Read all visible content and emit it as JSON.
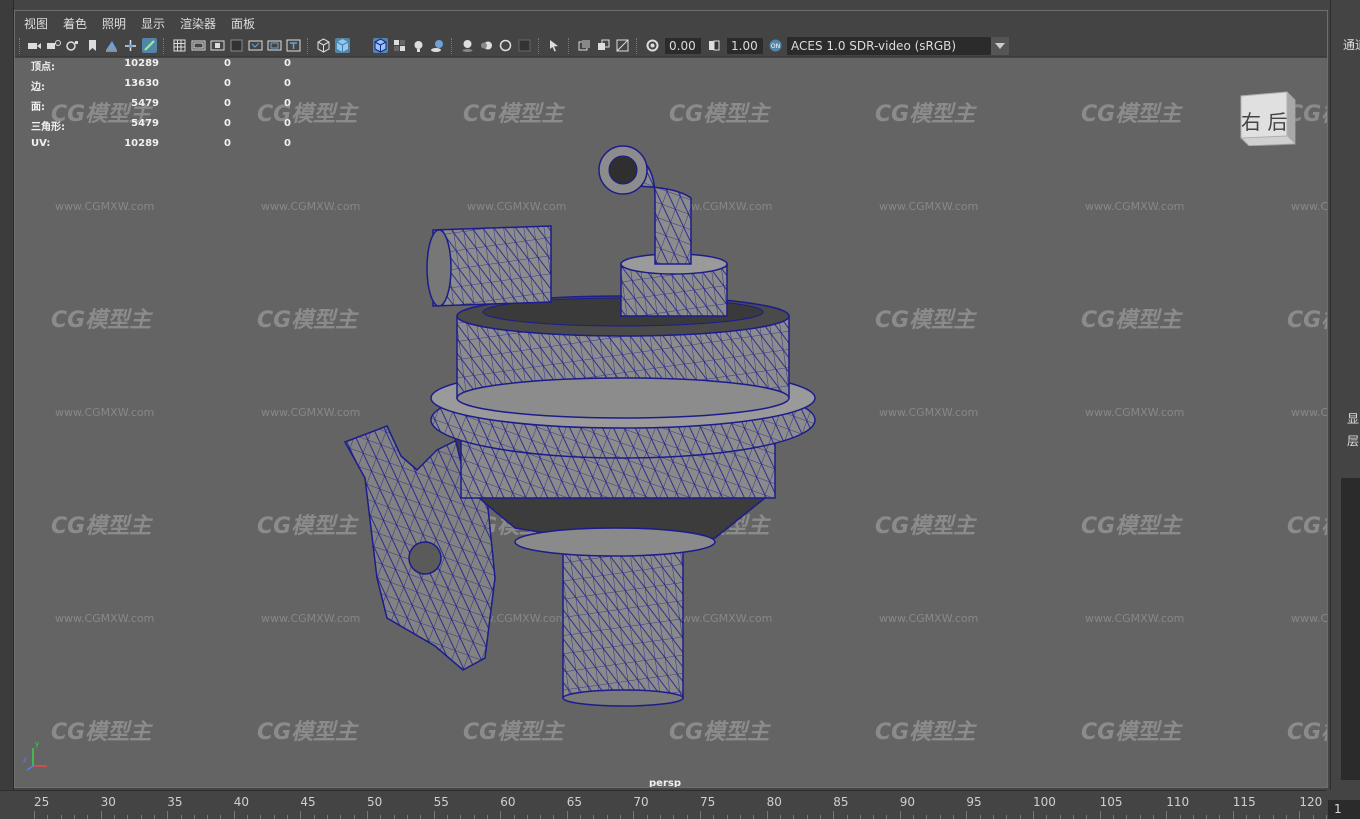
{
  "menu": [
    "视图",
    "着色",
    "照明",
    "显示",
    "渲染器",
    "面板"
  ],
  "toolbar": {
    "icons": [
      "camera-icon",
      "camera-attributes-icon",
      "bookmark-icon",
      "image-plane-icon",
      "2d-pan-zoom-icon",
      "grease-pencil-icon",
      "grid-icon",
      "film-gate-icon",
      "resolution-gate-icon",
      "gate-mask-icon",
      "field-chart-icon",
      "safe-action-icon",
      "safe-title-icon",
      "wireframe-icon",
      "smooth-shade-icon",
      "wireframe-on-shaded-icon",
      "textured-icon",
      "use-lights-icon",
      "shadows-icon",
      "screen-space-ao-icon",
      "motion-blur-icon",
      "multisample-aa-icon",
      "depth-of-field-icon",
      "isolate-select-icon",
      "xray-icon",
      "xray-joints-icon",
      "backface-culling-icon",
      "exposure-icon",
      "gamma-icon",
      "color-management-icon"
    ],
    "exposure_value": "0.00",
    "gamma_value": "1.00",
    "color_space": "ACES 1.0 SDR-video (sRGB)"
  },
  "hud": [
    {
      "label": "顶点:",
      "v1": "10289",
      "v2": "0",
      "v3": "0"
    },
    {
      "label": "边:",
      "v1": "13630",
      "v2": "0",
      "v3": "0"
    },
    {
      "label": "面:",
      "v1": "5479",
      "v2": "0",
      "v3": "0"
    },
    {
      "label": "三角形:",
      "v1": "5479",
      "v2": "0",
      "v3": "0"
    },
    {
      "label": "UV:",
      "v1": "10289",
      "v2": "0",
      "v3": "0"
    }
  ],
  "viewport": {
    "camera": "persp",
    "viewcube_label": "右 后"
  },
  "watermark": {
    "logo": "CG模型主",
    "url": "www.CGMXW.com"
  },
  "right_panel": {
    "label_top": "通道",
    "label_display": "显",
    "label_layer": "层"
  },
  "timeline": {
    "ticks": [
      "25",
      "30",
      "35",
      "40",
      "45",
      "50",
      "55",
      "60",
      "65",
      "70",
      "75",
      "80",
      "85",
      "90",
      "95",
      "100",
      "105",
      "110",
      "115",
      "120"
    ],
    "current_frame": "1"
  },
  "colors": {
    "viewport_bg": "#646464",
    "wireframe": "#1c1c8c",
    "active_icon": "#5285a6"
  }
}
